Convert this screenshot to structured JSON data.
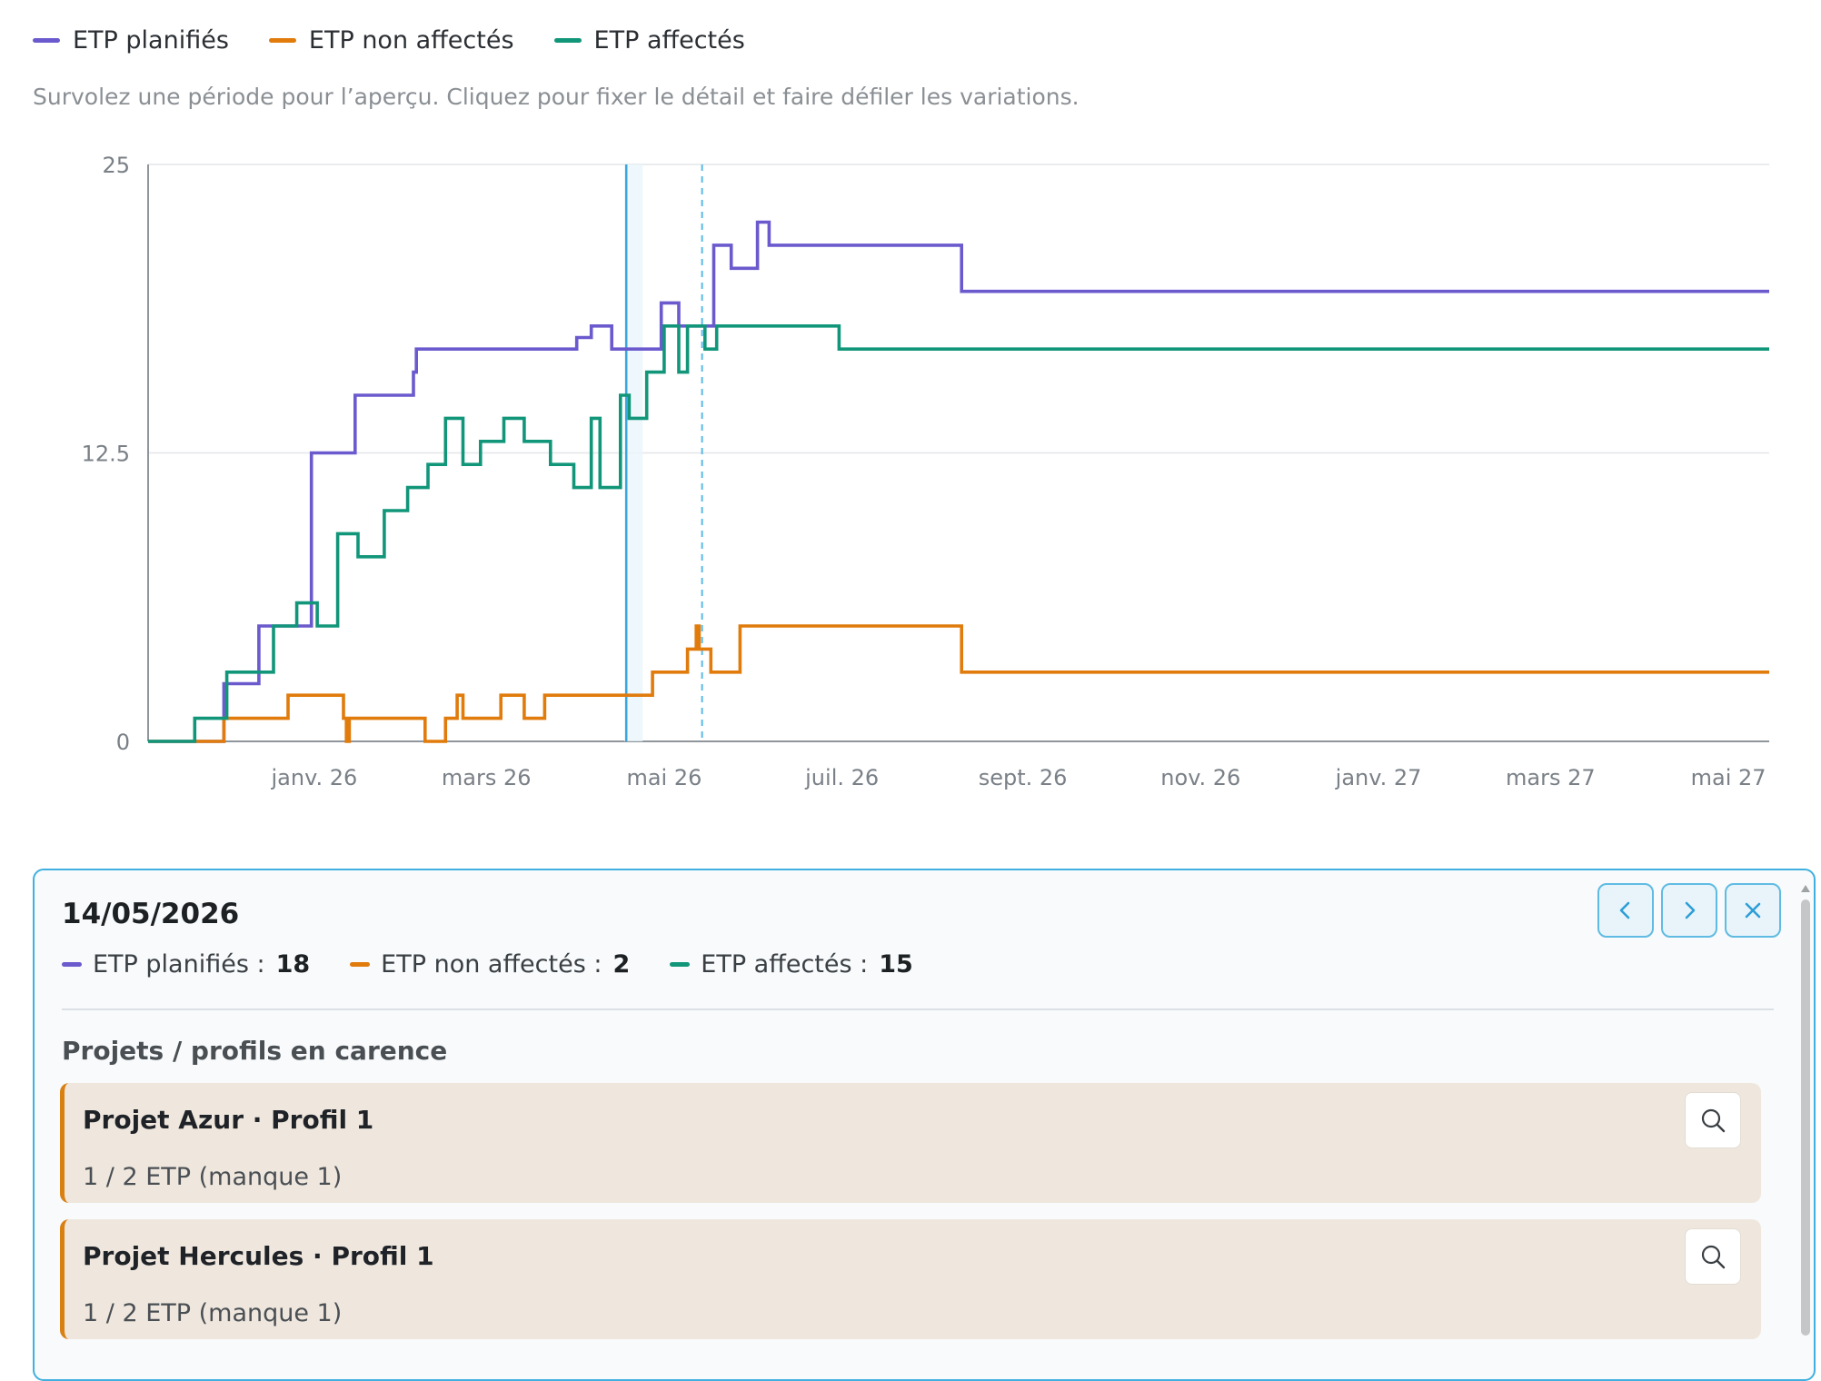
{
  "legend": [
    {
      "label": "ETP planifiés",
      "color": "#6a5acd"
    },
    {
      "label": "ETP non affectés",
      "color": "#e07b0c"
    },
    {
      "label": "ETP affectés",
      "color": "#12967a"
    }
  ],
  "hint": "Survolez une période pour l’aperçu. Cliquez pour fixer le détail et faire défiler les variations.",
  "chart_data": {
    "type": "line",
    "step": true,
    "y_ticks": [
      "0",
      "12.5",
      "25"
    ],
    "ylim": [
      0,
      25
    ],
    "x_ticks": [
      {
        "label": "janv. 26",
        "date": "2026-01-01"
      },
      {
        "label": "mars 26",
        "date": "2026-03-01"
      },
      {
        "label": "mai 26",
        "date": "2026-05-01"
      },
      {
        "label": "juil. 26",
        "date": "2026-07-01"
      },
      {
        "label": "sept. 26",
        "date": "2026-09-01"
      },
      {
        "label": "nov. 26",
        "date": "2026-11-01"
      },
      {
        "label": "janv. 27",
        "date": "2027-01-01"
      },
      {
        "label": "mars 27",
        "date": "2027-03-01"
      },
      {
        "label": "mai 27",
        "date": "2027-05-01"
      }
    ],
    "xlim": [
      "2025-11-05",
      "2027-05-15"
    ],
    "grid": true,
    "hover_date": "2026-04-18",
    "selected_date": "2026-05-14",
    "series": [
      {
        "name": "ETP planifiés",
        "color": "#6a5acd",
        "points": [
          [
            "2025-11-05",
            0
          ],
          [
            "2025-11-20",
            0
          ],
          [
            "2025-12-01",
            2.5
          ],
          [
            "2025-12-13",
            5
          ],
          [
            "2025-12-31",
            12.5
          ],
          [
            "2026-01-15",
            15
          ],
          [
            "2026-02-04",
            16
          ],
          [
            "2026-02-05",
            17
          ],
          [
            "2026-04-01",
            17.5
          ],
          [
            "2026-04-06",
            18
          ],
          [
            "2026-04-13",
            17
          ],
          [
            "2026-04-30",
            19
          ],
          [
            "2026-05-06",
            18
          ],
          [
            "2026-05-18",
            21.5
          ],
          [
            "2026-05-24",
            20.5
          ],
          [
            "2026-06-02",
            22.5
          ],
          [
            "2026-06-06",
            21.5
          ],
          [
            "2026-08-11",
            19.5
          ],
          [
            "2027-05-15",
            19.5
          ]
        ]
      },
      {
        "name": "ETP non affectés",
        "color": "#e07b0c",
        "points": [
          [
            "2025-11-05",
            0
          ],
          [
            "2025-11-20",
            0
          ],
          [
            "2025-12-01",
            1
          ],
          [
            "2025-12-23",
            2
          ],
          [
            "2026-01-11",
            1
          ],
          [
            "2026-01-12",
            0
          ],
          [
            "2026-01-13",
            1
          ],
          [
            "2026-02-08",
            0
          ],
          [
            "2026-02-15",
            1
          ],
          [
            "2026-02-19",
            2
          ],
          [
            "2026-02-21",
            1
          ],
          [
            "2026-03-06",
            2
          ],
          [
            "2026-03-14",
            1
          ],
          [
            "2026-03-21",
            2
          ],
          [
            "2026-04-27",
            3
          ],
          [
            "2026-05-09",
            4
          ],
          [
            "2026-05-12",
            5
          ],
          [
            "2026-05-13",
            4
          ],
          [
            "2026-05-17",
            3
          ],
          [
            "2026-05-27",
            5
          ],
          [
            "2026-08-11",
            3
          ],
          [
            "2027-05-15",
            3
          ]
        ]
      },
      {
        "name": "ETP affectés",
        "color": "#12967a",
        "points": [
          [
            "2025-11-05",
            0
          ],
          [
            "2025-11-20",
            0
          ],
          [
            "2025-11-21",
            1
          ],
          [
            "2025-12-02",
            3
          ],
          [
            "2025-12-18",
            5
          ],
          [
            "2025-12-26",
            6
          ],
          [
            "2026-01-02",
            5
          ],
          [
            "2026-01-09",
            9
          ],
          [
            "2026-01-16",
            8
          ],
          [
            "2026-01-25",
            10
          ],
          [
            "2026-02-02",
            11
          ],
          [
            "2026-02-09",
            12
          ],
          [
            "2026-02-15",
            14
          ],
          [
            "2026-02-21",
            12
          ],
          [
            "2026-02-27",
            13
          ],
          [
            "2026-03-07",
            14
          ],
          [
            "2026-03-14",
            13
          ],
          [
            "2026-03-23",
            12
          ],
          [
            "2026-03-31",
            11
          ],
          [
            "2026-04-06",
            14
          ],
          [
            "2026-04-09",
            11
          ],
          [
            "2026-04-16",
            15
          ],
          [
            "2026-04-19",
            14
          ],
          [
            "2026-04-25",
            16
          ],
          [
            "2026-05-01",
            18
          ],
          [
            "2026-05-06",
            16
          ],
          [
            "2026-05-09",
            18
          ],
          [
            "2026-05-15",
            17
          ],
          [
            "2026-05-19",
            18
          ],
          [
            "2026-06-30",
            17
          ],
          [
            "2027-05-15",
            17
          ]
        ]
      }
    ]
  },
  "detail": {
    "date": "14/05/2026",
    "stats": [
      {
        "label": "ETP planifiés :",
        "value": "18",
        "color": "#6a5acd"
      },
      {
        "label": "ETP non affectés :",
        "value": "2",
        "color": "#e07b0c"
      },
      {
        "label": "ETP affectés :",
        "value": "15",
        "color": "#12967a"
      }
    ],
    "section_title": "Projets / profils en carence",
    "cards": [
      {
        "title": "Projet Azur · Profil 1",
        "sub": "1 / 2 ETP (manque 1)"
      },
      {
        "title": "Projet Hercules · Profil 1",
        "sub": "1 / 2 ETP (manque 1)"
      }
    ]
  }
}
